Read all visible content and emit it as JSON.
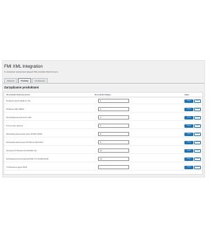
{
  "page": {
    "title": "FMI XML Integration",
    "description": "Tu zarządzasz powiązaniami kategorii XML produktów WooCommerce."
  },
  "tabs": [
    {
      "label": "Kategorie",
      "active": false
    },
    {
      "label": "Produkty",
      "active": true
    },
    {
      "label": "Konfiguracja",
      "active": false
    }
  ],
  "section": {
    "title": "Zarządzanie produktami"
  },
  "table": {
    "headers": {
      "name": "ID produktu WooCommerce",
      "id": "ID produktu Magno",
      "actions": "Akcje"
    },
    "save_label": "Zapisz",
    "delete_label": "Usuń",
    "rows": [
      {
        "name": "54 Monitor ASUS VZ24E 27\" Full",
        "id_value": "1"
      },
      {
        "name": "55 Monitor SSB TD9624",
        "id_value": "2"
      },
      {
        "name": "56 Drukarka laserowa Xerox C310",
        "id_value": "3"
      },
      {
        "name": "57 Lione Pen Optimize",
        "id_value": "4"
      },
      {
        "name": "58 Drukarka atramentowa Canon PIXMA TS3354",
        "id_value": "8"
      },
      {
        "name": "59 Drukarka atramentowa HP OfficeJet 8012 BOG",
        "id_value": "5"
      },
      {
        "name": "60 Kamera IP Hikvision DS-2CD1011-I(F)",
        "id_value": "11"
      },
      {
        "name": "62 Drukarka termiczna Zebra/XSTAR Tmx 5170E1FF/500",
        "id_value": "12"
      },
      {
        "name": "73 Obudowa Logitech HD45",
        "id_value": ""
      }
    ]
  },
  "colors": {
    "accent": "#2271b1",
    "background": "#f0f0f1"
  }
}
